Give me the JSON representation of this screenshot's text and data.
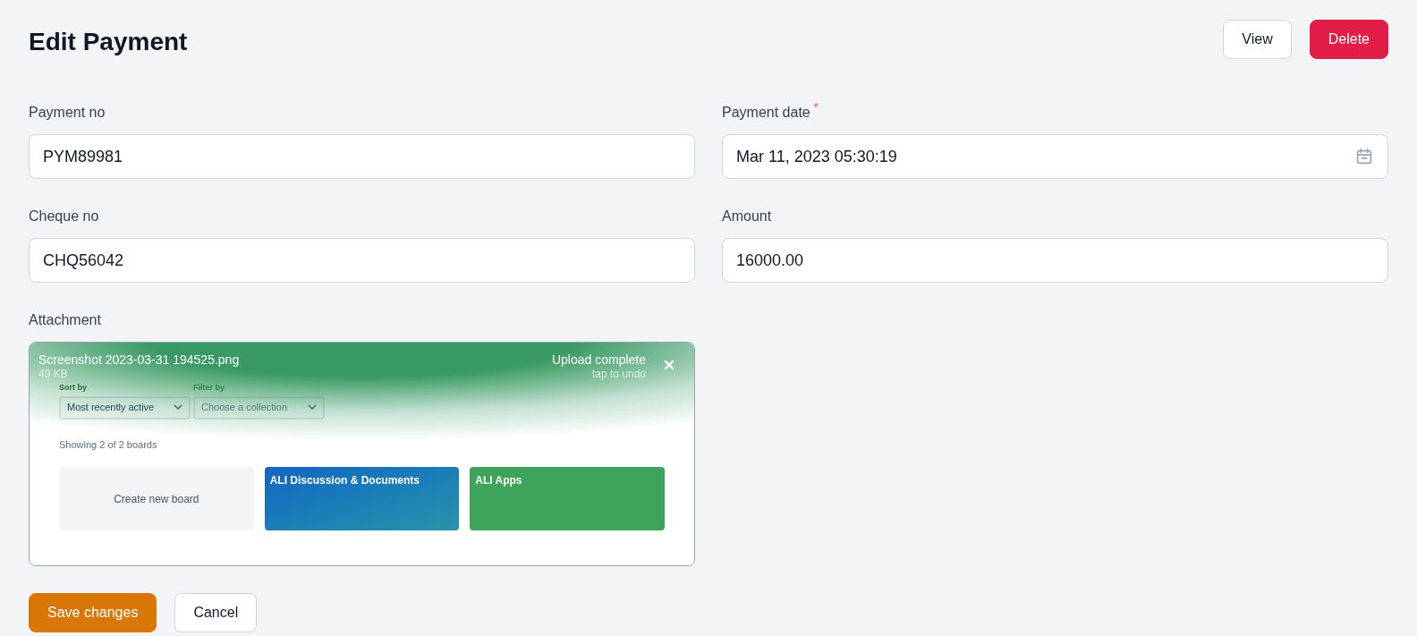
{
  "title": "Edit Payment",
  "required_mark": "*",
  "header_buttons": [
    {
      "label": "View",
      "kind": "secondary"
    },
    {
      "label": "Delete",
      "kind": "danger"
    }
  ],
  "fields": [
    {
      "label": "Payment no",
      "value": "PYM89981",
      "required": false,
      "kind": "text"
    },
    {
      "label": "Payment date",
      "value": "Mar 11, 2023 05:30:19",
      "required": true,
      "kind": "date"
    },
    {
      "label": "Cheque no",
      "value": "CHQ56042",
      "required": false,
      "kind": "text"
    },
    {
      "label": "Amount",
      "value": "16000.00",
      "required": false,
      "kind": "text"
    }
  ],
  "attachment": {
    "label": "Attachment",
    "file_name": "Screenshot 2023-03-31 194525.png",
    "file_size": "49 KB",
    "status": "Upload complete",
    "hint": "tap to undo",
    "preview": {
      "sort_label": "Sort by",
      "sort_value": "Most recently active",
      "filter_label": "Filter by",
      "filter_value": "Choose a collection",
      "count": "Showing 2 of 2 boards",
      "boards": [
        {
          "title": "Create new board",
          "kind": "new"
        },
        {
          "title": "ALI Discussion & Documents",
          "kind": "blue"
        },
        {
          "title": "ALI Apps",
          "kind": "green"
        }
      ]
    }
  },
  "footer_buttons": [
    {
      "label": "Save changes",
      "kind": "primary"
    },
    {
      "label": "Cancel",
      "kind": "secondary"
    }
  ]
}
